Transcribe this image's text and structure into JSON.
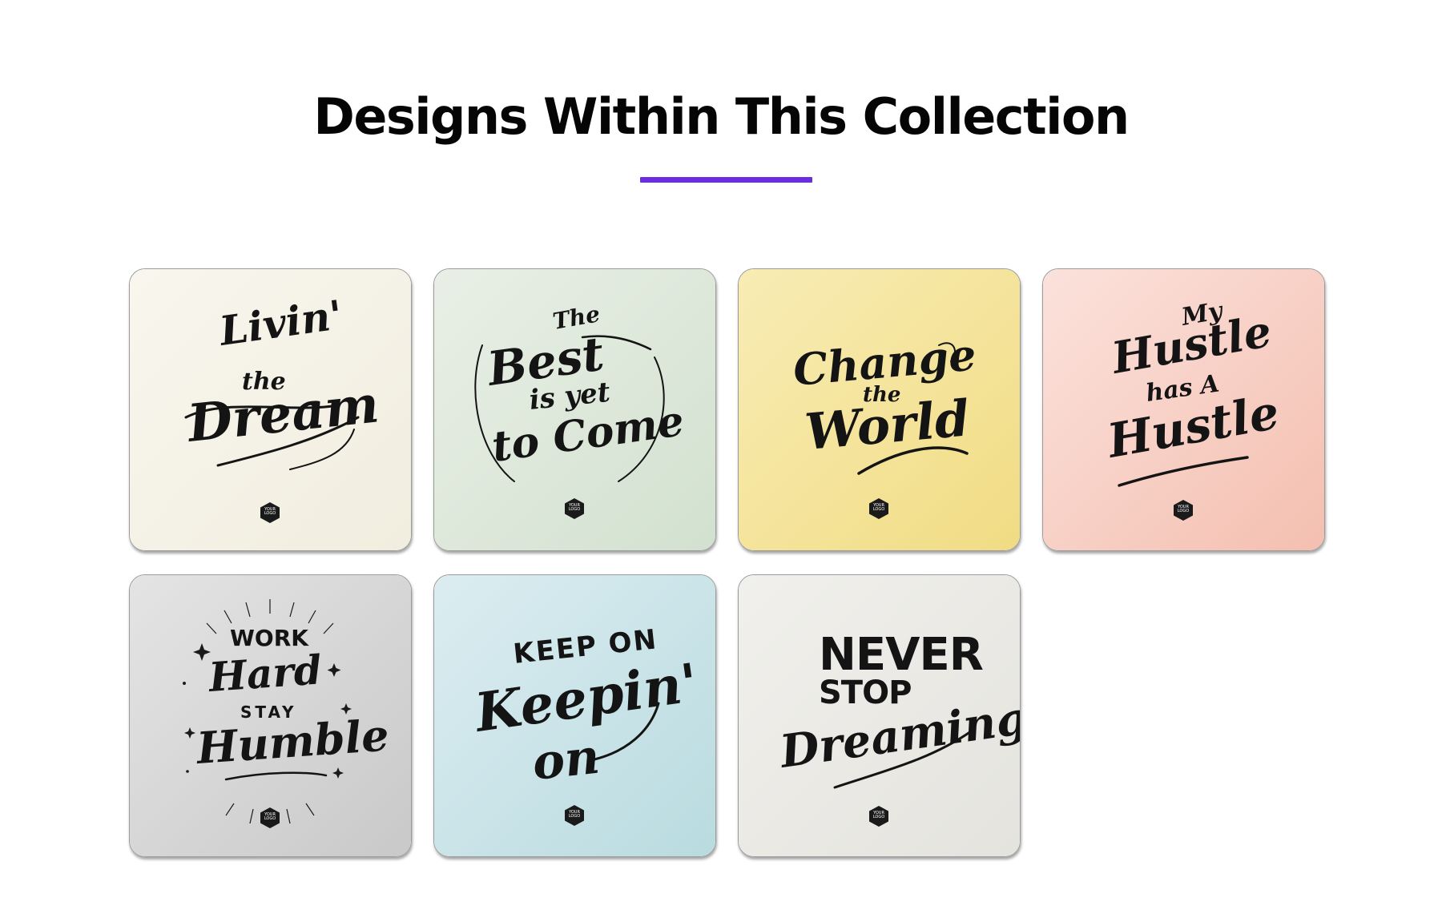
{
  "page": {
    "title": "Designs Within This Collection",
    "accent_color": "#6a2ee0"
  },
  "designs": [
    {
      "lines": [
        "Livin'",
        "the",
        "Dream"
      ],
      "background": [
        "#f8f6ee",
        "#f1eddf"
      ],
      "logo_text": "YOUR\nLOGO"
    },
    {
      "lines": [
        "The",
        "Best",
        "is yet",
        "to Come"
      ],
      "background": [
        "#e9efe6",
        "#d2e1cf"
      ],
      "logo_text": "YOUR\nLOGO"
    },
    {
      "lines": [
        "Change",
        "the",
        "World"
      ],
      "background": [
        "#f8ecb4",
        "#f1dc84"
      ],
      "logo_text": "YOUR\nLOGO"
    },
    {
      "lines": [
        "My",
        "Hustle",
        "has A",
        "Hustle"
      ],
      "background": [
        "#fbe2dc",
        "#f4bfb0"
      ],
      "logo_text": "YOUR\nLOGO"
    },
    {
      "lines": [
        "WORK",
        "Hard",
        "STAY",
        "Humble"
      ],
      "background": [
        "#e4e4e4",
        "#c9c9c9"
      ],
      "logo_text": "YOUR\nLOGO"
    },
    {
      "lines": [
        "KEEP ON",
        "Keepin'",
        "on"
      ],
      "background": [
        "#dcedf1",
        "#b9dbe0"
      ],
      "logo_text": "YOUR\nLOGO"
    },
    {
      "lines": [
        "NEVER",
        "STOP",
        "Dreaming"
      ],
      "background": [
        "#f1f0ec",
        "#e4e3de"
      ],
      "logo_text": "YOUR\nLOGO"
    }
  ]
}
